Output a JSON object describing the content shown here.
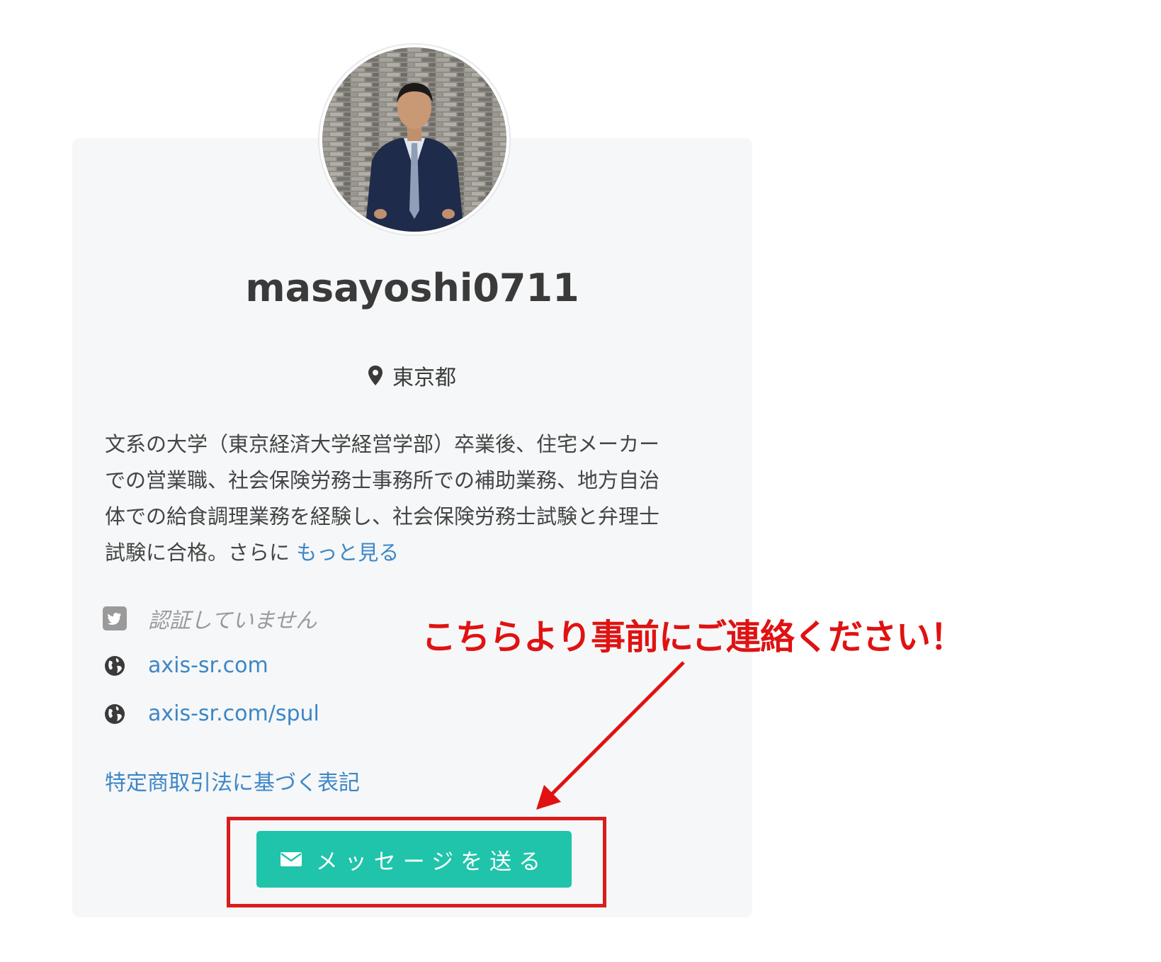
{
  "profile": {
    "username": "masayoshi0711",
    "location": "東京都",
    "bio_lines": [
      "文系の大学（東京経済大学経営学部）卒業後、住宅メーカー",
      "での営業職、社会保険労務士事務所での補助業務、地方自治",
      "体での給食調理業務を経験し、社会保険労務士試験と弁理士",
      "試験に合格。さらに "
    ],
    "more_link": "もっと見る",
    "twitter_status": "認証していません",
    "websites": [
      "axis-sr.com",
      "axis-sr.com/spul"
    ],
    "legal_link": "特定商取引法に基づく表記",
    "send_message_label": "メッセージを送る"
  },
  "annotation": {
    "text": "こちらより事前にご連絡ください！",
    "color": "#e01212"
  },
  "colors": {
    "link": "#3d86c6",
    "button": "#1fc4aa",
    "card_bg": "#f5f7f8"
  },
  "icons": {
    "location": "map-pin-icon",
    "twitter": "twitter-icon",
    "website": "globe-icon",
    "message": "envelope-icon"
  }
}
